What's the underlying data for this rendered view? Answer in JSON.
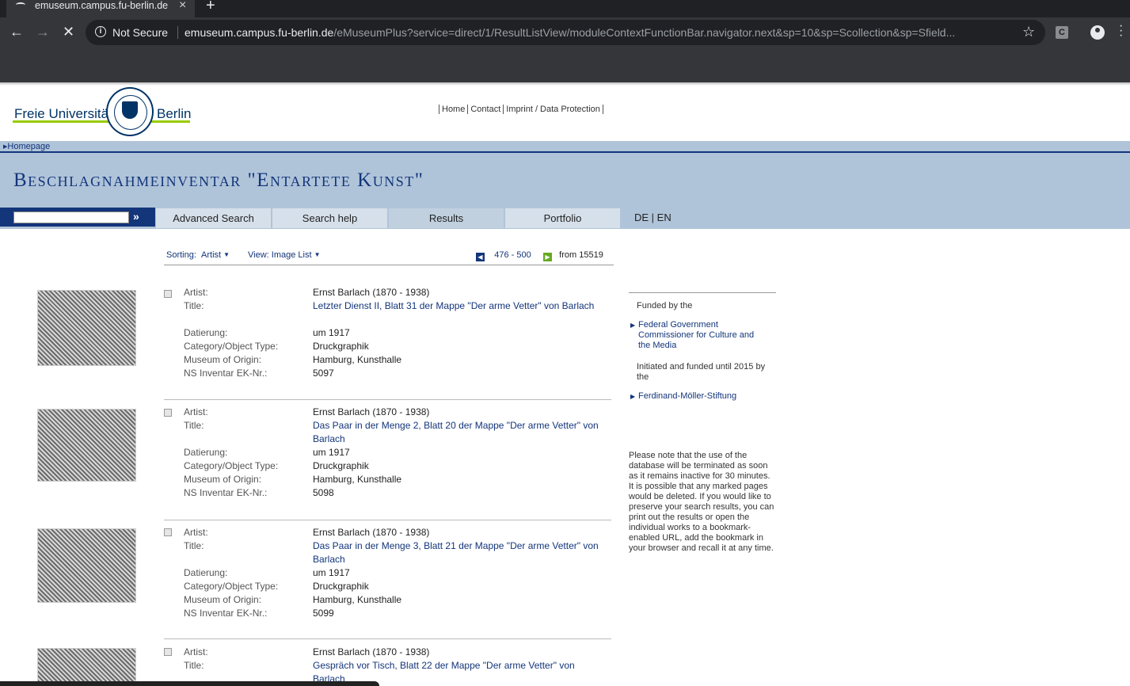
{
  "browser": {
    "tab_title": "emuseum.campus.fu-berlin.de",
    "new_tab": "+",
    "security": "Not Secure",
    "url_host": "emuseum.campus.fu-berlin.de",
    "url_path": "/eMuseumPlus?service=direct/1/ResultListView/moduleContextFunctionBar.navigator.next&sp=10&sp=Scollection&sp=Sfield...",
    "extension_label": "C"
  },
  "header": {
    "logo_left": "Freie Universität",
    "logo_right": "Berlin",
    "links": [
      "Home",
      "Contact",
      "Imprint / Data Protection"
    ],
    "breadcrumb": "Homepage",
    "title": "Beschlagnahmeinventar \"Entartete Kunst\""
  },
  "nav": {
    "search_go": "»",
    "tabs": [
      "Advanced Search",
      "Search help",
      "Results",
      "Portfolio"
    ],
    "lang": "DE | EN"
  },
  "controls": {
    "sorting_label": "Sorting:",
    "sorting_value": "Artist",
    "view_label": "View:",
    "view_value": "Image List",
    "range": "476 - 500",
    "from": "from 15519"
  },
  "field_labels": {
    "artist": "Artist:",
    "title": "Title:",
    "date": "Datierung:",
    "category": "Category/Object Type:",
    "museum": "Museum of Origin:",
    "inventory": "NS Inventar EK-Nr.:"
  },
  "records": [
    {
      "artist": "Ernst Barlach (1870 - 1938)",
      "title": "Letzter Dienst II, Blatt 31 der Mappe \"Der arme Vetter\" von Barlach",
      "date": "um 1917",
      "category": "Druckgraphik",
      "museum": "Hamburg, Kunsthalle",
      "inventory": "5097"
    },
    {
      "artist": "Ernst Barlach (1870 - 1938)",
      "title": "Das Paar in der Menge 2, Blatt 20 der Mappe \"Der arme Vetter\" von Barlach",
      "date": "um 1917",
      "category": "Druckgraphik",
      "museum": "Hamburg, Kunsthalle",
      "inventory": "5098"
    },
    {
      "artist": "Ernst Barlach (1870 - 1938)",
      "title": "Das Paar in der Menge 3, Blatt 21 der Mappe \"Der arme Vetter\" von Barlach",
      "date": "um 1917",
      "category": "Druckgraphik",
      "museum": "Hamburg, Kunsthalle",
      "inventory": "5099"
    },
    {
      "artist": "Ernst Barlach (1870 - 1938)",
      "title": "Gespräch vor Tisch, Blatt 22 der Mappe \"Der arme Vetter\" von Barlach"
    }
  ],
  "sidebar": {
    "funded_by": "Funded by the",
    "funder_link": "Federal Government Commissioner for Culture and the Media",
    "initiated": "Initiated and funded until 2015 by the",
    "initiator_link": "Ferdinand-Möller-Stiftung",
    "note": "Please note that the use of the database will be terminated as soon as it remains inactive for 30 minutes. It is possible that any marked pages would be deleted. If you would like to preserve your search results, you can print out the results or open the individual works to a bookmark-enabled URL, add the bookmark in your browser and recall it at any time."
  }
}
